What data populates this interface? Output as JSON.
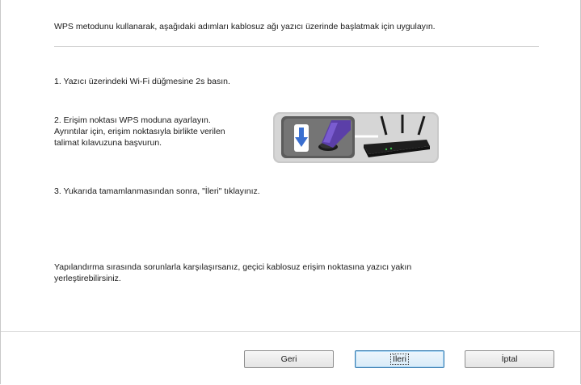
{
  "intro_text": "WPS metodunu kullanarak, aşağıdaki adımları kablosuz ağı yazıcı üzerinde başlatmak için uygulayın.",
  "steps": {
    "step1": "1. Yazıcı üzerindeki Wi-Fi düğmesine 2s basın.",
    "step2_line1": "2. Erişim noktası WPS moduna ayarlayın.",
    "step2_line2": "Ayrıntılar için, erişim noktasıyla birlikte verilen",
    "step2_line3": "talimat kılavuzuna başvurun.",
    "step3": "3. Yukarıda tamamlanmasından sonra, \"İleri\" tıklayınız."
  },
  "note_line1": "Yapılandırma sırasında sorunlarla karşılaşırsanız, geçici kablosuz erişim noktasına yazıcı yakın",
  "note_line2": "yerleştirebilirsiniz.",
  "buttons": {
    "back": "Geri",
    "next": "İleri",
    "cancel": "İptal"
  },
  "colors": {
    "accent": "#e0303a",
    "default_button_border": "#3c7fb1",
    "illustration_panel": "#c9c9c9",
    "press_arrow": "#3a6fd0",
    "finger": "#5b3fa8"
  },
  "icons": {
    "illustration": "wps-router-illustration",
    "arrow": "down-arrow-icon",
    "finger": "pressing-finger-icon",
    "router": "router-icon"
  }
}
